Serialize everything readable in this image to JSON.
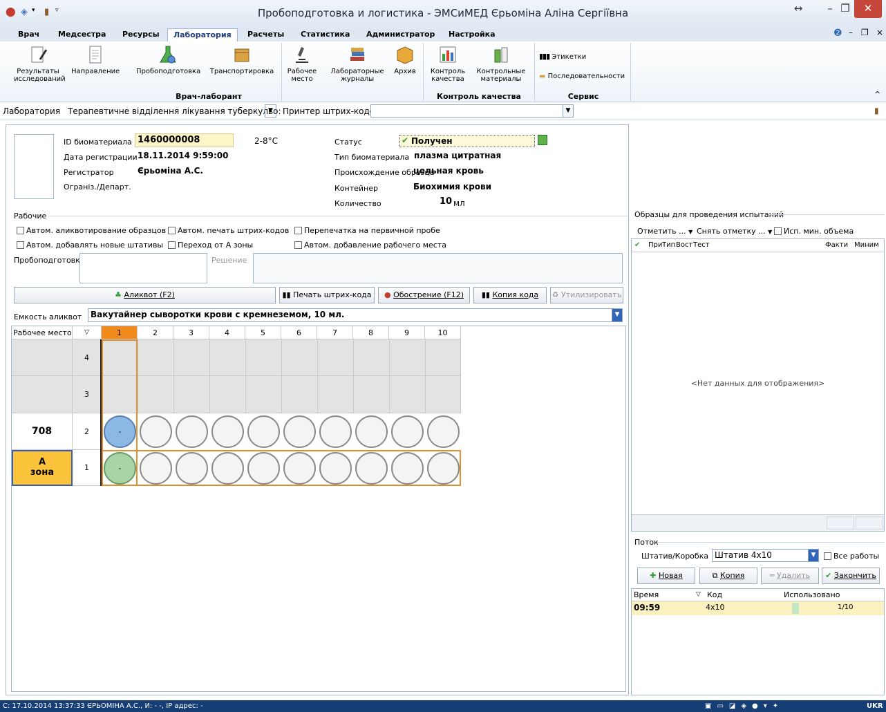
{
  "window": {
    "title": "Пробоподготовка и логистика - ЭМСиМЕД Єрьоміна Аліна Сергіївна"
  },
  "tabs": [
    "Врач",
    "Медсестра",
    "Ресурсы",
    "Лаборатория",
    "Расчеты",
    "Статистика",
    "Администратор",
    "Настройка"
  ],
  "ribbon": {
    "results_line1": "Результаты",
    "results_line2": "исследований",
    "direction": "Направление",
    "sampleprep": "Пробоподготовка",
    "transport": "Транспортировка",
    "workplace_line1": "Рабочее",
    "workplace_line2": "место",
    "journals_line1": "Лабораторные",
    "journals_line2": "журналы",
    "archive": "Архив",
    "qc_line1": "Контроль",
    "qc_line2": "качества",
    "ctrl_line1": "Контрольные",
    "ctrl_line2": "материалы",
    "labels": "Этикетки",
    "sequences": "Последовательности",
    "group_doctor": "Врач-лаборант",
    "group_qc": "Контроль качества",
    "group_service": "Сервис"
  },
  "location": {
    "label": "Лаборатория",
    "department": "Терапевтичне відділення лікування туберкульо:",
    "printer": "Принтер штрих-кодов"
  },
  "sample": {
    "id_label": "ID биоматериала",
    "id_value": "1460000008",
    "temp": "2-8°C",
    "regdate_label": "Дата регистрации",
    "regdate_value": "18.11.2014 9:59:00",
    "registrar_label": "Регистратор",
    "registrar_value": "Єрьоміна А.С.",
    "org_label": "Огранiз./Департ.",
    "status_label": "Статус",
    "status_value": "Получен",
    "type_label": "Тип биоматериала",
    "type_value": "плазма цитратная",
    "origin_label": "Происхождение образца",
    "origin_value": "цельная кровь",
    "container_label": "Контейнер",
    "container_value": "Биохимия крови",
    "qty_label": "Количество",
    "qty_value": "10",
    "qty_unit": "мл"
  },
  "work": {
    "section": "Рабочие",
    "cb1": "Автом. аликвотирование образцов",
    "cb2": "Автом. печать штрих-кодов",
    "cb3": "Перепечатка на первичной пробе",
    "cb4": "Автом. добавлять новые штативы",
    "cb5": "Переход от А зоны",
    "cb6": "Автом. добавление рабочего места",
    "prep_label": "Пробоподготовка",
    "decision_label": "Решение",
    "btn_aliquot": "Аликвот (F2)",
    "btn_print": "Печать штрих-кода",
    "btn_escalate": "Обострение (F12)",
    "btn_copy_code": "Копия кода",
    "btn_dispose": "Утилизировать",
    "capacity_label": "Емкость аликвот",
    "capacity_value": "Вакутайнер сыворотки крови с кремнеземом, 10 мл."
  },
  "grid": {
    "col_workplace": "Рабочее место",
    "columns": [
      "1",
      "2",
      "3",
      "4",
      "5",
      "6",
      "7",
      "8",
      "9",
      "10"
    ],
    "rows": [
      {
        "n": "4",
        "workplace": ""
      },
      {
        "n": "3",
        "workplace": ""
      },
      {
        "n": "2",
        "workplace": "708"
      },
      {
        "n": "1",
        "workplace_l1": "А",
        "workplace_l2": "зона"
      }
    ],
    "dash": "-"
  },
  "samples_panel": {
    "title": "Образцы для проведения испытаний",
    "mark": "Отметить ...",
    "unmark": "Снять отметку ...",
    "min_volume": "Исп. мин. объема",
    "h_pri": "При",
    "h_type": "Тип",
    "h_vost": "Вост",
    "h_test": "Тест",
    "h_fact": "Факти",
    "h_min": "Миним",
    "empty": "<Нет данных для отображения>"
  },
  "flow": {
    "title": "Поток",
    "rack_label": "Штатив/Коробка",
    "rack_value": "Штатив 4x10",
    "all_works": "Все работы",
    "btn_new": "Новая",
    "btn_copy": "Копия",
    "btn_delete": "Удалить",
    "btn_finish": "Закончить",
    "h_time": "Время",
    "h_code": "Код",
    "h_used": "Использовано",
    "row_time": "09:59",
    "row_code": "4x10",
    "row_used": "1/10"
  },
  "statusbar": {
    "text": "С: 17.10.2014 13:37:33 ЄРЬОМІНА А.С., И: - -, IP адрес: -",
    "lang": "UKR"
  }
}
